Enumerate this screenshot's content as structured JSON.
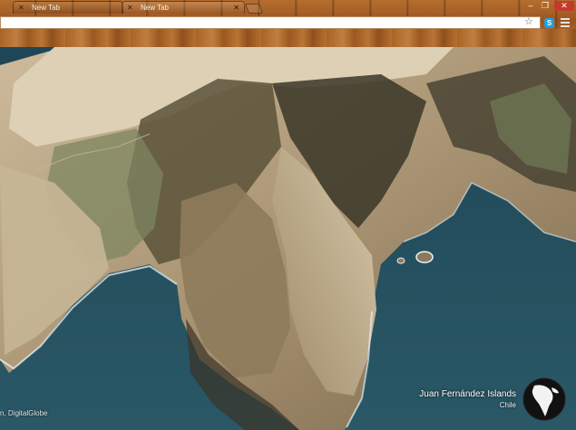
{
  "tabs": [
    {
      "title": "New Tab"
    },
    {
      "title": "New Tab"
    }
  ],
  "window_controls": {
    "minimize": "–",
    "maximize": "❐",
    "close": "✕"
  },
  "address_bar": {
    "value": ""
  },
  "toolbar": {
    "star": "☆",
    "extension": "S"
  },
  "background": {
    "attribution": "n, DigitalGlobe",
    "place_name": "Juan Fernández Islands",
    "place_country": "Chile"
  }
}
